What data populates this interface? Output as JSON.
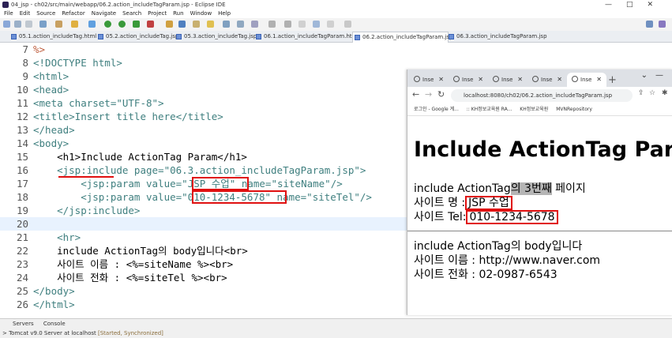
{
  "window": {
    "title": "04_jsp - ch02/src/main/webapp/06.2.action_includeTagParam.jsp - Eclipse IDE",
    "controls": [
      "—",
      "□",
      "✕"
    ]
  },
  "menu": [
    "File",
    "Edit",
    "Source",
    "Refactor",
    "Navigate",
    "Search",
    "Project",
    "Run",
    "Window",
    "Help"
  ],
  "editor_tabs": [
    {
      "label": "05.1.action_includeTag.html"
    },
    {
      "label": "05.2.action_includeTag.jsp"
    },
    {
      "label": "05.3.action_includeTag.jsp"
    },
    {
      "label": "06.1.action_includeTagParam.html"
    },
    {
      "label": "06.2.action_includeTagParam.jsp",
      "active": true
    },
    {
      "label": "06.3.action_includeTagParam.jsp"
    }
  ],
  "code_lines": [
    {
      "n": "7",
      "text": "%>"
    },
    {
      "n": "8",
      "text": "<!DOCTYPE html>"
    },
    {
      "n": "9",
      "text": "<html>"
    },
    {
      "n": "10",
      "text": "<head>"
    },
    {
      "n": "11",
      "text": "<meta charset=\"UTF-8\">"
    },
    {
      "n": "12",
      "text": "<title>Insert title here</title>"
    },
    {
      "n": "13",
      "text": "</head>"
    },
    {
      "n": "14",
      "text": "<body>"
    },
    {
      "n": "15",
      "text": "    <h1>Include ActionTag Param</h1>"
    },
    {
      "n": "16",
      "text": "    <jsp:include page=\"06.3.action_includeTagParam.jsp\">"
    },
    {
      "n": "17",
      "text": "        <jsp:param value=\"JSP 수업\" name=\"siteName\"/>"
    },
    {
      "n": "18",
      "text": "        <jsp:param value=\"010-1234-5678\" name=\"siteTel\"/>"
    },
    {
      "n": "19",
      "text": "    </jsp:include>"
    },
    {
      "n": "20",
      "text": ""
    },
    {
      "n": "21",
      "text": "    <hr>"
    },
    {
      "n": "22",
      "text": "    include ActionTag의 body입니다<br>"
    },
    {
      "n": "23",
      "text": "    사이트 이름 : <%=siteName %><br>"
    },
    {
      "n": "24",
      "text": "    사이트 전화 : <%=siteTel %><br>"
    },
    {
      "n": "25",
      "text": "</body>"
    },
    {
      "n": "26",
      "text": "</html>"
    }
  ],
  "bottom_panel": {
    "tabs": [
      "Servers",
      "Console"
    ],
    "server_entry": "Tomcat v9.0 Server at localhost",
    "server_status": "[Started, Synchronized]"
  },
  "browser": {
    "tabs": [
      "Inse",
      "Inse",
      "Inse",
      "Inse",
      "Inse"
    ],
    "active_tab": 4,
    "url": "localhost:8080/ch02/06.2.action_includeTagParam.jsp",
    "bookmarks": [
      "로그인 - Google 계...",
      ":: KH정보교육원 RA...",
      "KH정보교육원",
      "MVNRepository"
    ],
    "page": {
      "heading": "Include ActionTag Param",
      "line1_prefix": "include ActionTag",
      "line1_highlight": "의 3번째",
      "line1_suffix": " 페이지",
      "site_name_label": "사이트 명 :",
      "site_name_value": "JSP 수업",
      "site_tel_label": "사이트 Tel:",
      "site_tel_value": "010-1234-5678",
      "body_line": "include ActionTag의 body입니다",
      "site_name_line": "사이트 이름 : http://www.naver.com",
      "site_tel_line": "사이트 전화 : 02-0987-6543"
    }
  }
}
